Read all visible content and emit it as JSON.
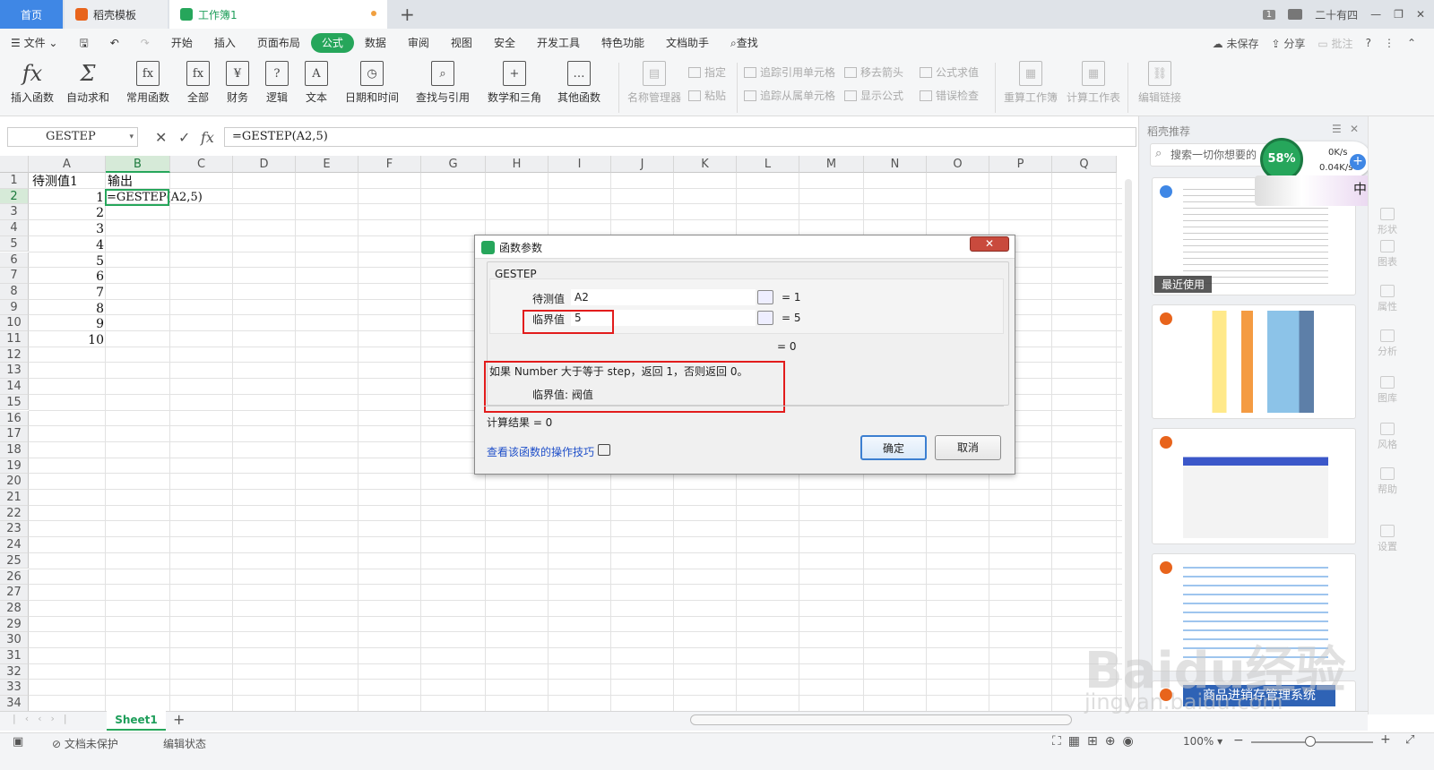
{
  "titlebar": {
    "tabs": [
      "首页",
      "稻壳模板",
      "工作簿1"
    ],
    "page_badge": "1",
    "user": "二十有四"
  },
  "menubar": {
    "file": "文件",
    "items": [
      "开始",
      "插入",
      "页面布局",
      "公式",
      "数据",
      "审阅",
      "视图",
      "安全",
      "开发工具",
      "特色功能",
      "文档助手"
    ],
    "find": "查找",
    "unsaved": "未保存",
    "share": "分享",
    "comment": "批注"
  },
  "ribbon": {
    "big_buttons": [
      "插入函数",
      "自动求和",
      "常用函数",
      "全部",
      "财务",
      "逻辑",
      "文本",
      "日期和时间",
      "查找与引用",
      "数学和三角",
      "其他函数",
      "名称管理器"
    ],
    "small": [
      "指定",
      "粘贴",
      "追踪引用单元格",
      "追踪从属单元格",
      "移去箭头",
      "显示公式",
      "公式求值",
      "错误检查"
    ],
    "right_big": [
      "重算工作簿",
      "计算工作表",
      "编辑链接"
    ]
  },
  "formula_bar": {
    "name_box": "GESTEP",
    "formula": "=GESTEP(A2,5)"
  },
  "grid": {
    "columns": [
      "A",
      "B",
      "C",
      "D",
      "E",
      "F",
      "G",
      "H",
      "I",
      "J",
      "K",
      "L",
      "M",
      "N",
      "O",
      "P",
      "Q"
    ],
    "row_count": 34,
    "header_row": {
      "A": "待测值1",
      "B": "输出"
    },
    "a_values": [
      "1",
      "2",
      "3",
      "4",
      "5",
      "6",
      "7",
      "8",
      "9",
      "10"
    ],
    "b2": "=GESTEP(A2,5)"
  },
  "dialog": {
    "title": "函数参数",
    "function_name": "GESTEP",
    "args": [
      {
        "label": "待测值",
        "value": "A2",
        "result": "= 1"
      },
      {
        "label": "临界值",
        "value": "5",
        "result": "= 5"
      }
    ],
    "total_result": "= 0",
    "description": "如果 Number 大于等于 step，返回 1，否则返回 0。",
    "param_help": "临界值:  阀值",
    "calc_result": "计算结果 =  0",
    "help_link": "查看该函数的操作技巧",
    "ok": "确定",
    "cancel": "取消"
  },
  "right_panel": {
    "title": "稻壳推荐",
    "search_placeholder": "搜索一切你想要的",
    "recent_label": "最近使用",
    "speed_percent": "58%",
    "speed_up": "0K/s",
    "speed_down": "0.04K/s",
    "banner_text": "商品进销存管理系统",
    "ime": "中"
  },
  "sidebar": [
    "形状",
    "图表",
    "属性",
    "分析",
    "图库",
    "风格",
    "帮助",
    "设置"
  ],
  "sheets": {
    "active": "Sheet1"
  },
  "statusbar": {
    "protect": "文档未保护",
    "mode": "编辑状态",
    "zoom": "100%"
  },
  "watermark": {
    "main": "Baidu经验",
    "sub": "jingyan.baidu.com"
  },
  "colors": {
    "accent": "#26a65b",
    "tab_home": "#3f87e5",
    "highlight_red": "#e21c1c"
  }
}
